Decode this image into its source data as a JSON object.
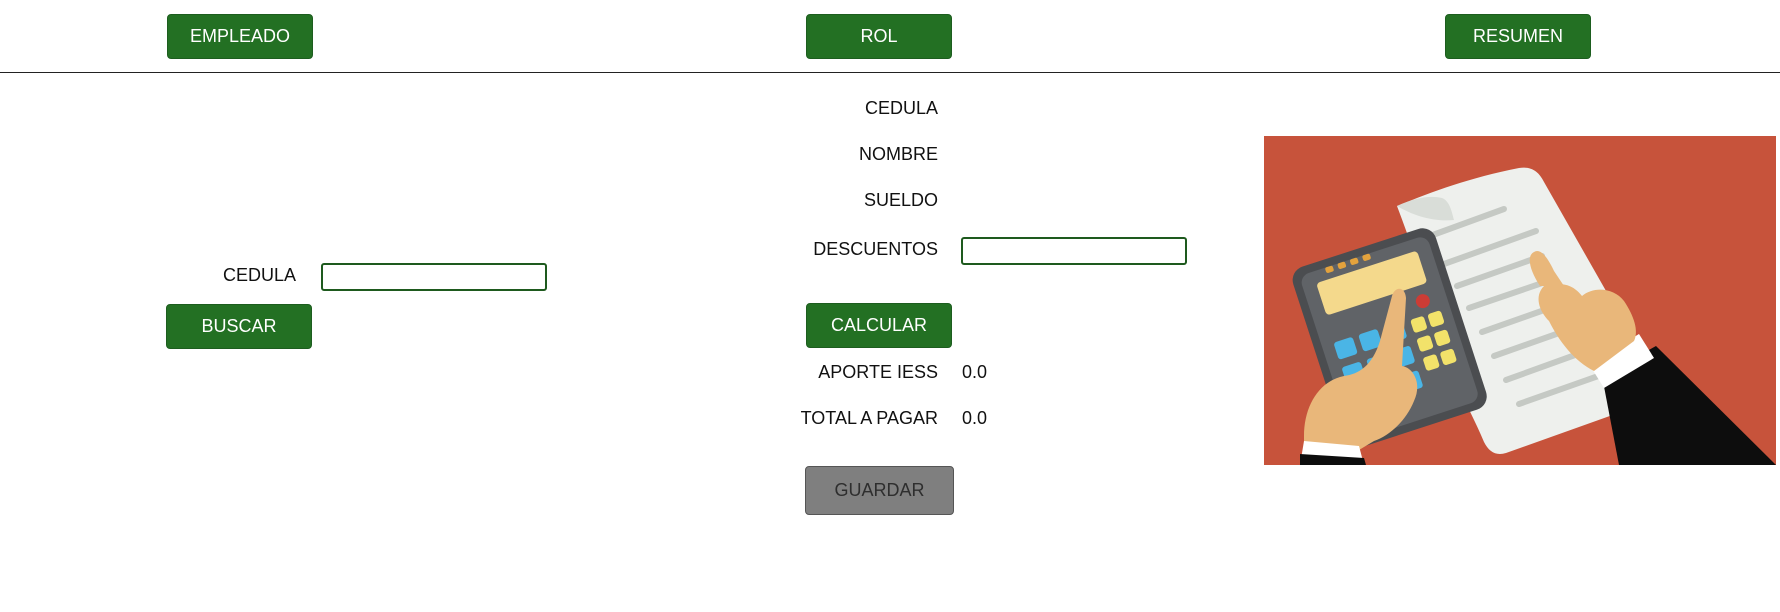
{
  "nav": {
    "employee_label": "EMPLEADO",
    "payroll_label": "ROL",
    "summary_label": "RESUMEN"
  },
  "search": {
    "cedula_label": "CEDULA",
    "cedula_value": "",
    "search_label": "BUSCAR"
  },
  "payroll": {
    "cedula_label": "CEDULA",
    "cedula_value": "",
    "nombre_label": "NOMBRE",
    "nombre_value": "",
    "sueldo_label": "SUELDO",
    "sueldo_value": "",
    "descuentos_label": "DESCUENTOS",
    "descuentos_value": "",
    "calculate_label": "CALCULAR",
    "aporte_label": "APORTE IESS",
    "aporte_value": "0.0",
    "total_label": "TOTAL A PAGAR",
    "total_value": "0.0",
    "save_label": "GUARDAR",
    "save_enabled": false
  },
  "illustration": {
    "icon": "calculator-invoice-illustration",
    "background_color": "#c7533b"
  },
  "colors": {
    "primary_button": "#237023",
    "disabled_button": "#7f7f7f",
    "input_border": "#1e5a1e"
  }
}
